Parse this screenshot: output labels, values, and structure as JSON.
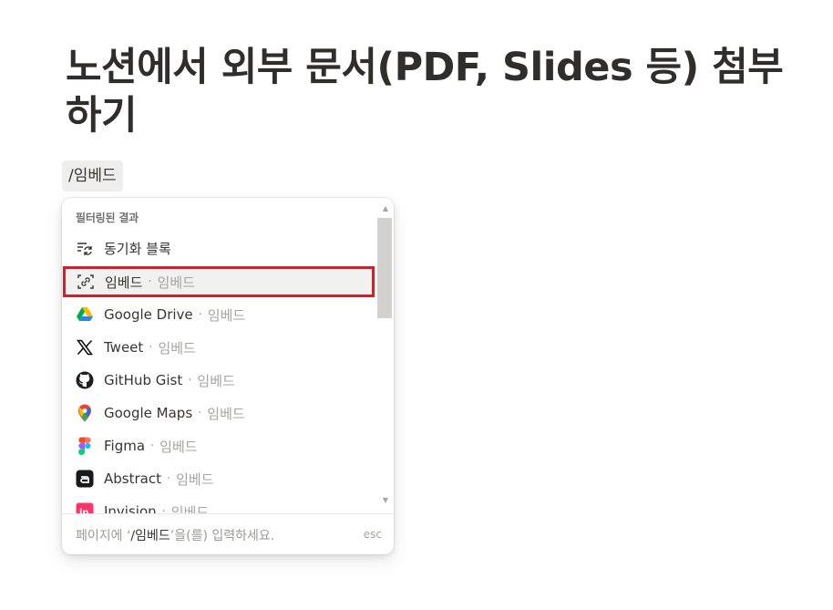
{
  "page": {
    "title": "노션에서 외부 문서(PDF, Slides 등) 첨부하기",
    "slash_query": "/임베드"
  },
  "menu": {
    "section_label": "필터링된 결과",
    "items": [
      {
        "label": "동기화 블록",
        "sub": "",
        "icon": "sync-block-icon"
      },
      {
        "label": "임베드",
        "sub": "임베드",
        "icon": "embed-icon",
        "selected": true
      },
      {
        "label": "Google Drive",
        "sub": "임베드",
        "icon": "google-drive-icon"
      },
      {
        "label": "Tweet",
        "sub": "임베드",
        "icon": "x-logo-icon"
      },
      {
        "label": "GitHub Gist",
        "sub": "임베드",
        "icon": "github-icon"
      },
      {
        "label": "Google Maps",
        "sub": "임베드",
        "icon": "google-maps-icon"
      },
      {
        "label": "Figma",
        "sub": "임베드",
        "icon": "figma-icon"
      },
      {
        "label": "Abstract",
        "sub": "임베드",
        "icon": "abstract-icon"
      },
      {
        "label": "Invision",
        "sub": "임베드",
        "icon": "invision-icon"
      }
    ],
    "separator": "·",
    "footer": {
      "hint_prefix": "페이지에 ‘",
      "hint_keyword": "/임베드",
      "hint_suffix": "’을(를) 입력하세요.",
      "esc": "esc"
    }
  },
  "colors": {
    "highlight_border": "#d1202c",
    "selected_bg": "#f1f1ef",
    "chip_bg": "#efeeec"
  }
}
